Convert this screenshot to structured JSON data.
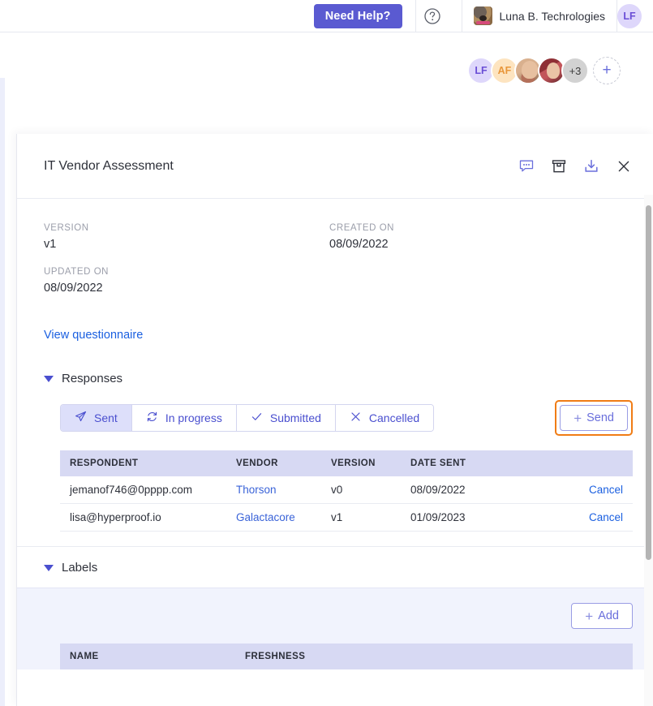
{
  "topbar": {
    "need_help_label": "Need Help?",
    "help_icon": "question-circle-icon",
    "org_name": "Luna B. Techrologies",
    "org_avatar_alt": "dog-photo-avatar",
    "user_initials": "LF"
  },
  "collaborators": {
    "avatars": [
      {
        "type": "initials",
        "label": "LF"
      },
      {
        "type": "initials",
        "label": "AF"
      },
      {
        "type": "photo",
        "label": ""
      },
      {
        "type": "photo",
        "label": ""
      },
      {
        "type": "overflow",
        "label": "+3"
      }
    ],
    "add_label": "+"
  },
  "panel": {
    "title": "IT Vendor Assessment",
    "actions": [
      {
        "name": "comment-icon",
        "label": ""
      },
      {
        "name": "archive-icon",
        "label": ""
      },
      {
        "name": "download-icon",
        "label": ""
      },
      {
        "name": "close-icon",
        "label": ""
      }
    ],
    "meta": [
      {
        "label": "VERSION",
        "value": "v1"
      },
      {
        "label": "CREATED ON",
        "value": "08/09/2022"
      },
      {
        "label": "UPDATED ON",
        "value": "08/09/2022"
      }
    ],
    "view_questionnaire_label": "View questionnaire"
  },
  "responses": {
    "section_title": "Responses",
    "tabs": [
      {
        "label": "Sent",
        "icon": "send-plane-icon",
        "active": true
      },
      {
        "label": "In progress",
        "icon": "refresh-icon",
        "active": false
      },
      {
        "label": "Submitted",
        "icon": "check-icon",
        "active": false
      },
      {
        "label": "Cancelled",
        "icon": "x-icon",
        "active": false
      }
    ],
    "send_button_label": "Send",
    "send_button_highlight_color": "#f07c15",
    "columns": [
      "RESPONDENT",
      "VENDOR",
      "VERSION",
      "DATE SENT",
      ""
    ],
    "rows": [
      {
        "respondent": "jemanof746@0pppp.com",
        "vendor": "Thorson",
        "version": "v0",
        "date_sent": "08/09/2022",
        "action": "Cancel"
      },
      {
        "respondent": "lisa@hyperproof.io",
        "vendor": "Galactacore",
        "version": "v1",
        "date_sent": "01/09/2023",
        "action": "Cancel"
      }
    ]
  },
  "labels": {
    "section_title": "Labels",
    "add_button_label": "Add",
    "columns": [
      "NAME",
      "FRESHNESS",
      ""
    ],
    "rows": []
  },
  "colors": {
    "brand_purple": "#5a5ad1",
    "link_blue": "#1a5fe0",
    "table_header": "#d7d9f3",
    "accent_orange": "#f07c15"
  }
}
